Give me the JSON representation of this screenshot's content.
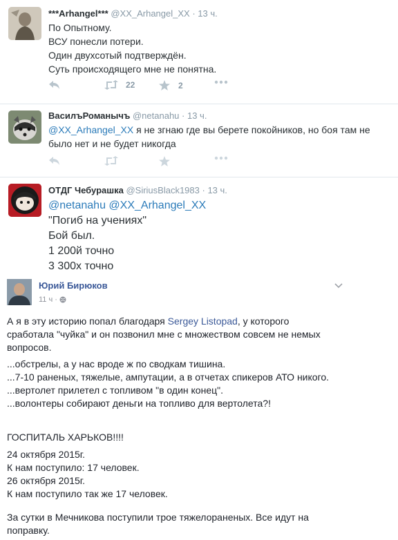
{
  "tweets": [
    {
      "name": "***Arhangel***",
      "handle": "@XX_Arhangel_XX",
      "time": "· 13 ч.",
      "lines": [
        "По Опытному.",
        "ВСУ понесли потери.",
        "Один двухсотый подтверждён.",
        "Суть происходящего мне не понятна."
      ],
      "retweets": "22",
      "likes": "2"
    },
    {
      "name": "ВасилъРоманычъ",
      "handle": "@netanahu",
      "time": "· 13 ч.",
      "mention": "@XX_Arhangel_XX",
      "text_line1": " я не згнаю где вы берете покойников, но боя там не",
      "text_line2": "было нет и не будет никогда"
    },
    {
      "name": "ОТДГ Чебурашка",
      "handle": "@SiriusBlack1983",
      "time": "· 13 ч.",
      "mentions": "@netanahu @XX_Arhangel_XX",
      "lines": [
        "\"Погиб на учениях\"",
        "Бой был.",
        "1 200й точно",
        "3 300х точно"
      ]
    }
  ],
  "fb_post": {
    "author": "Юрий Бирюков",
    "meta": "11 ч ·",
    "intro_1a": "А я в эту историю попал благодаря ",
    "intro_link": "Sergey Listopad",
    "intro_1b": ", у которого",
    "intro_2": "сработала \"чуйка\" и он позвонил мне с множеством совсем не немых",
    "intro_3": "вопросов.",
    "list": [
      "...обстрелы, а у нас вроде ж по сводкам тишина.",
      "...7-10 раненых, тяжелые, ампутации, а в отчетах спикеров АТО никого.",
      "...вертолет прилетел с топливом \"в один конец\".",
      "...волонтеры собирают деньги на топливо для вертолета?!"
    ],
    "hospital": "ГОСПИТАЛЬ ХАРЬКОВ!!!!",
    "dates": [
      "24 октября 2015г.",
      "К нам поступило: 17 человек.",
      "26 октября 2015г.",
      "К нам поступило так же 17 человек."
    ],
    "outro_1": "За сутки в Мечникова поступили трое тяжелораненых. Все идут на",
    "outro_2": "поправку."
  },
  "colors": {
    "link": "#2b7bb9",
    "muted": "#8899a6",
    "fb_link": "#3b5998"
  }
}
